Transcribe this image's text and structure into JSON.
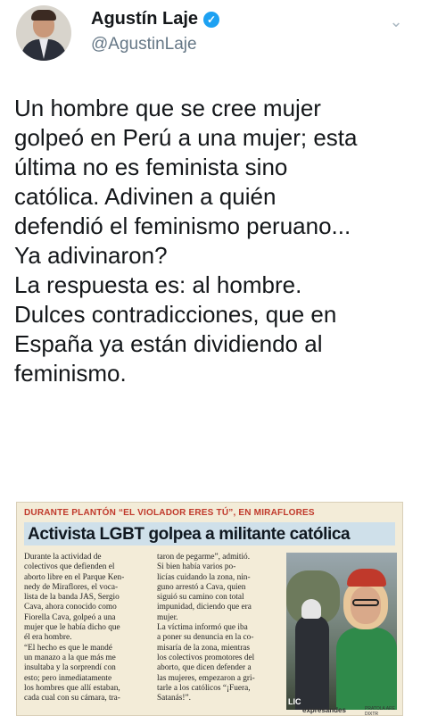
{
  "profile": {
    "name": "Agustín Laje",
    "handle": "@AgustinLaje"
  },
  "tweet": {
    "text": "Un hombre que se cree mujer\ngolpeó en Perú a una mujer; esta\núltima no es feminista sino\ncatólica. Adivinen a quién\ndefendió el feminismo peruano...\nYa adivinaron?\nLa respuesta es: al hombre.\nDulces contradicciones, que en\nEspaña ya están dividiendo al\nfeminismo."
  },
  "clipping": {
    "kicker": "DURANTE PLANTÓN “EL VIOLADOR ERES TÚ”, EN MIRAFLORES",
    "headline": "Activista LGBT golpea a militante católica",
    "col1": "Durante la actividad de\ncolectivos que defienden el\naborto libre en el Parque Ken-\nnedy de Miraflores, el voca-\nlista de la banda JAS, Sergio\nCava, ahora conocido como\nFiorella Cava, golpeó a una\nmujer que le había dicho que\nél era hombre.\n“El hecho es que le mandé\nun manazo a la que más me\ninsultaba y la sorprendí con\nesto; pero inmediatamente\nlos hombres que allí estaban,\ncada cual con su cámara, tra-",
    "col2": "taron de pegarme”, admitió.\nSi bien había varios po-\nlicías cuidando la zona, nin-\nguno arrestó a Cava, quien\nsiguió su camino con total\nimpunidad, diciendo que era\nmujer.\nLa víctima informó que iba\na poner su denuncia en la co-\nmisaría de la zona, mientras\nlos colectivos promotores del\naborto, que dicen defender a\nlas mujeres, empezaron a gri-\ntarle a los católicos “¡Fuera,\nSatanás!”.",
    "photo_label": "LIC",
    "credit": "expresandes",
    "credit_small": "PRATOLA ARE DIXTR Prosikueder"
  },
  "icons": {
    "verified": "verified-badge-icon",
    "menu": "chevron-down-icon"
  },
  "colors": {
    "verified": "#1da1f2",
    "handle": "#657786",
    "kicker": "#c0392b",
    "headline_band": "#cfe0ea"
  }
}
